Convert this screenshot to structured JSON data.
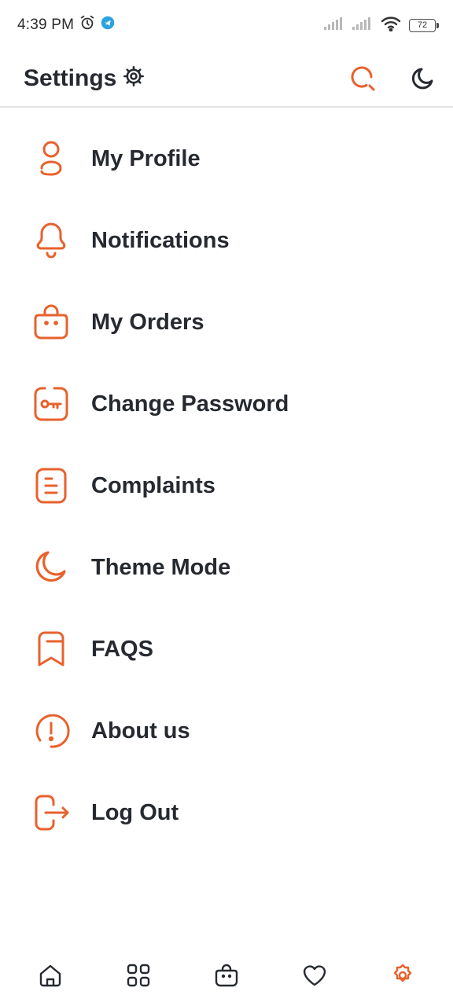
{
  "status_bar": {
    "time": "4:39 PM",
    "battery": "72",
    "icons": [
      "alarm-icon",
      "telegram-icon",
      "signal-icon",
      "signal-icon",
      "wifi-icon",
      "battery-icon"
    ]
  },
  "header": {
    "title": "Settings",
    "title_icon": "gear-icon",
    "actions": [
      "search-icon",
      "moon-icon"
    ]
  },
  "menu": {
    "items": [
      {
        "label": "My Profile",
        "icon": "user-icon"
      },
      {
        "label": "Notifications",
        "icon": "bell-icon"
      },
      {
        "label": "My Orders",
        "icon": "shopping-bag-icon"
      },
      {
        "label": "Change Password",
        "icon": "key-icon"
      },
      {
        "label": "Complaints",
        "icon": "document-icon"
      },
      {
        "label": "Theme Mode",
        "icon": "moon-icon"
      },
      {
        "label": "FAQS",
        "icon": "bookmark-icon"
      },
      {
        "label": "About us",
        "icon": "info-icon"
      },
      {
        "label": "Log Out",
        "icon": "logout-icon"
      }
    ]
  },
  "bottom_nav": {
    "items": [
      "home-icon",
      "grid-icon",
      "bag-icon",
      "heart-icon",
      "gear-icon"
    ],
    "active": "gear-icon"
  },
  "colors": {
    "accent": "#e8612c",
    "text": "#262a30",
    "divider": "#e4e4e4"
  }
}
